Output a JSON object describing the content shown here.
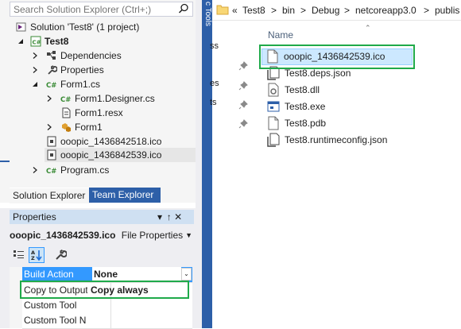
{
  "solution_explorer": {
    "search_placeholder": "Search Solution Explorer (Ctrl+;)",
    "solution": "Solution 'Test8' (1 project)",
    "project": "Test8",
    "items": [
      {
        "label": "Dependencies"
      },
      {
        "label": "Properties"
      },
      {
        "label": "Form1.cs"
      },
      {
        "label": "Form1.Designer.cs"
      },
      {
        "label": "Form1.resx"
      },
      {
        "label": "Form1"
      },
      {
        "label": "ooopic_1436842518.ico"
      },
      {
        "label": "ooopic_1436842539.ico"
      },
      {
        "label": "Program.cs"
      }
    ],
    "tabs": {
      "solution_explorer": "Solution Explorer",
      "team_explorer": "Team Explorer"
    },
    "side_label": "c Tools"
  },
  "properties": {
    "title": "Properties",
    "pin_glyph": "▾  ↑ ✕",
    "object_name": "ooopic_1436842539.ico",
    "object_type": "File Properties",
    "rows": [
      {
        "name": "Build Action",
        "value": "None"
      },
      {
        "name": "Copy to Output",
        "value": "Copy always"
      },
      {
        "name": "Custom Tool",
        "value": ""
      },
      {
        "name": "Custom Tool N",
        "value": ""
      }
    ]
  },
  "file_explorer": {
    "breadcrumb": [
      "«",
      "Test8",
      ">",
      "bin",
      ">",
      "Debug",
      ">",
      "netcoreapp3.0",
      ">",
      "publis"
    ],
    "column_header": "Name",
    "left_fragments": [
      "ss",
      "es",
      "ts"
    ],
    "files": [
      {
        "name": "ooopic_1436842539.ico"
      },
      {
        "name": "Test8.deps.json"
      },
      {
        "name": "Test8.dll"
      },
      {
        "name": "Test8.exe"
      },
      {
        "name": "Test8.pdb"
      },
      {
        "name": "Test8.runtimeconfig.json"
      }
    ]
  },
  "colors": {
    "highlight_green": "#1faa4a",
    "vs_blue": "#2d5fa8",
    "selection_blue": "#cce8ff"
  }
}
